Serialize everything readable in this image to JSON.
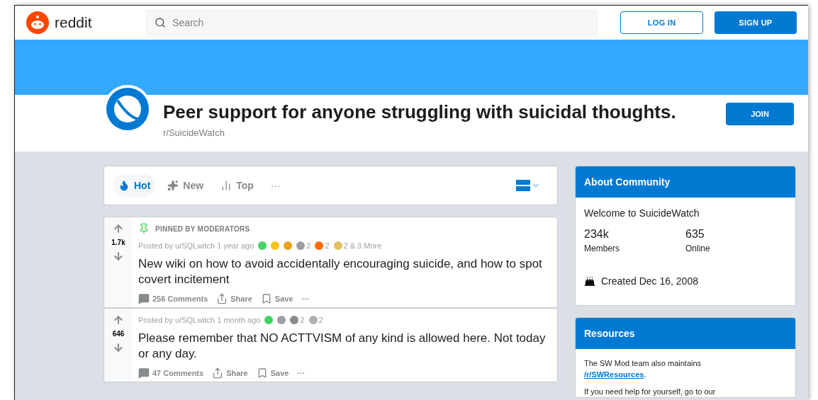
{
  "header": {
    "logo_text": "reddit",
    "search": {
      "placeholder": "Search"
    },
    "buttons": [
      {
        "label": "LOG IN",
        "kind": "outline"
      },
      {
        "label": "SIGN UP",
        "kind": "solid"
      }
    ]
  },
  "community": {
    "title": "Peer support for anyone struggling with suicidal thoughts.",
    "name": "r/SuicideWatch",
    "join": "JOIN"
  },
  "sort_tabs": [
    {
      "label": "Hot",
      "selected": true,
      "kind": "hot"
    },
    {
      "label": "New",
      "selected": false,
      "kind": "new"
    },
    {
      "label": "Top",
      "selected": false,
      "kind": "top"
    }
  ],
  "sort_more": "···",
  "posts": [
    {
      "pinned": true,
      "pinned_label": "PINNED BY MODERATORS",
      "votes": "1.7k",
      "posted": "Posted by u/SQLwitch 1 year ago",
      "awards": [
        {
          "color": "#46d160"
        },
        {
          "color": "#f5c518"
        },
        {
          "color": "#e8a317"
        },
        {
          "color": "#9aa0a6",
          "count": "2"
        },
        {
          "color": "#ff6a00",
          "count": "2"
        },
        {
          "color": "#e0c060",
          "count": "2 & 3 More"
        }
      ],
      "title": "New wiki on how to avoid accidentally encouraging suicide, and how to spot covert incitement",
      "actions": {
        "comments": "256 Comments",
        "share": "Share",
        "save": "Save",
        "more": "···"
      }
    },
    {
      "pinned": false,
      "votes": "646",
      "posted": "Posted by u/SQLwitch 1 month ago",
      "awards": [
        {
          "color": "#46d160"
        },
        {
          "color": "#9aa0a6"
        },
        {
          "color": "#8a8a8a",
          "count": "2"
        },
        {
          "color": "#b0b0b0",
          "count": "2"
        }
      ],
      "title": "Please remember that NO ACTTVISM of any kind is allowed here. Not today or any day.",
      "actions": {
        "comments": "47 Comments",
        "share": "Share",
        "save": "Save",
        "more": "···"
      }
    }
  ],
  "about": {
    "heading": "About Community",
    "welcome": "Welcome to SuicideWatch",
    "stats": [
      {
        "value": "234k",
        "label": "Members"
      },
      {
        "value": "635",
        "label": "Online"
      }
    ],
    "created": "Created Dec 16, 2008"
  },
  "resources": {
    "heading": "Resources",
    "text": "The SW Mod team also maintains",
    "link": "/r/SWResources",
    "after_link": ".",
    "cut_line": "If you need help for yourself, go to our"
  }
}
